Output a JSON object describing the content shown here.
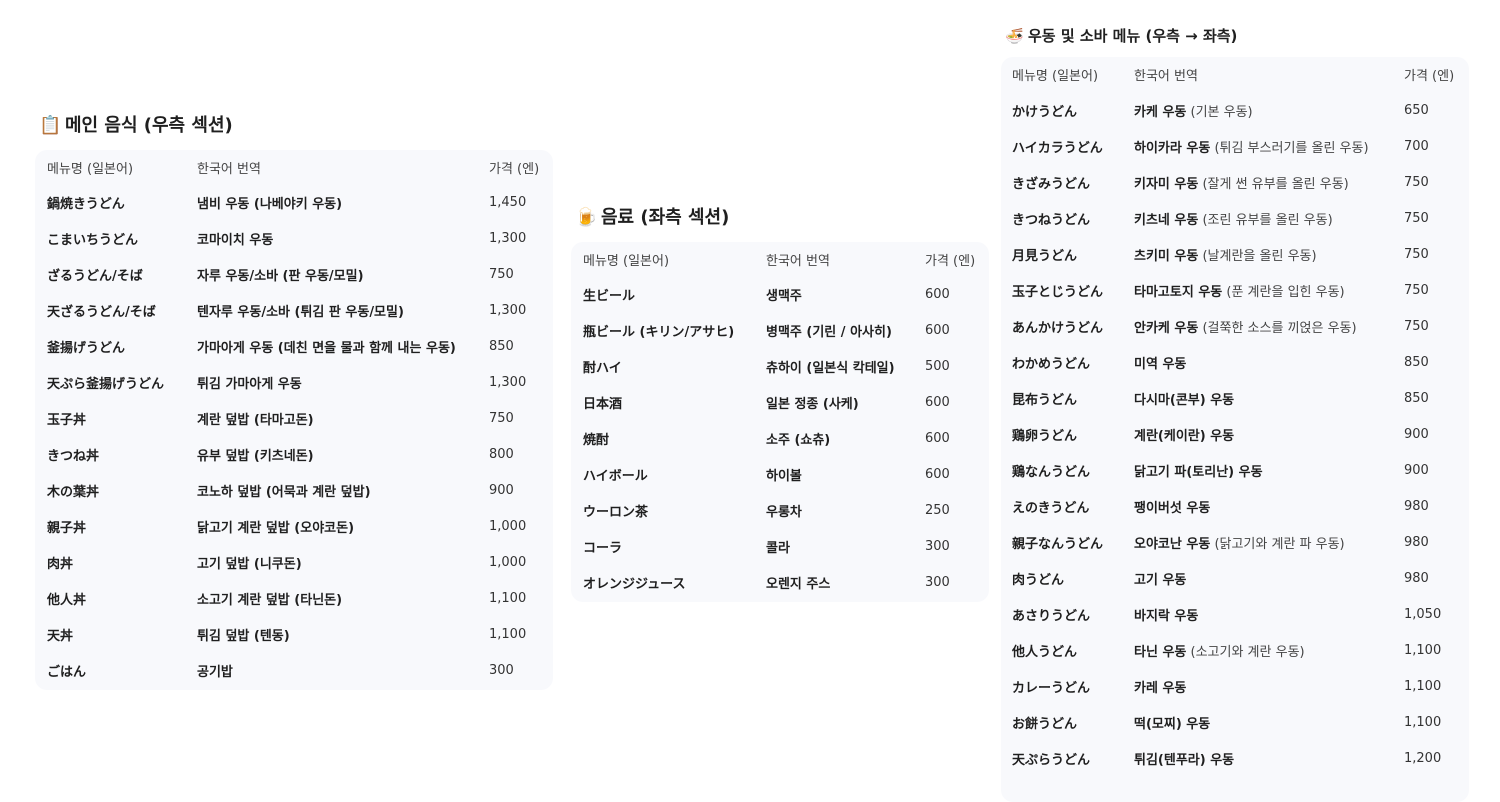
{
  "main": {
    "icon": "📋",
    "title": "메인 음식 (우측 섹션)",
    "headers": [
      "메뉴명 (일본어)",
      "한국어 번역",
      "가격 (엔)"
    ],
    "rows": [
      {
        "ja": "鍋焼きうどん",
        "ko": "냄비 우동 (나베야키 우동)",
        "note": "",
        "price": "1,450"
      },
      {
        "ja": "こまいちうどん",
        "ko": "코마이치 우동",
        "note": "",
        "price": "1,300"
      },
      {
        "ja": "ざるうどん/そば",
        "ko": "자루 우동/소바 (판 우동/모밀)",
        "note": "",
        "price": "750"
      },
      {
        "ja": "天ざるうどん/そば",
        "ko": "텐자루 우동/소바 (튀김 판 우동/모밀)",
        "note": "",
        "price": "1,300"
      },
      {
        "ja": "釜揚げうどん",
        "ko": "가마아게 우동 (데친 면을 물과 함께 내는 우동)",
        "note": "",
        "price": "850"
      },
      {
        "ja": "天ぷら釜揚げうどん",
        "ko": "튀김 가마아게 우동",
        "note": "",
        "price": "1,300"
      },
      {
        "ja": "玉子丼",
        "ko": "계란 덮밥 (타마고돈)",
        "note": "",
        "price": "750"
      },
      {
        "ja": "きつね丼",
        "ko": "유부 덮밥 (키츠네돈)",
        "note": "",
        "price": "800"
      },
      {
        "ja": "木の葉丼",
        "ko": "코노하 덮밥 (어묵과 계란 덮밥)",
        "note": "",
        "price": "900"
      },
      {
        "ja": "親子丼",
        "ko": "닭고기 계란 덮밥 (오야코돈)",
        "note": "",
        "price": "1,000"
      },
      {
        "ja": "肉丼",
        "ko": "고기 덮밥 (니쿠돈)",
        "note": "",
        "price": "1,000"
      },
      {
        "ja": "他人丼",
        "ko": "소고기 계란 덮밥 (타닌돈)",
        "note": "",
        "price": "1,100"
      },
      {
        "ja": "天丼",
        "ko": "튀김 덮밥 (텐동)",
        "note": "",
        "price": "1,100"
      },
      {
        "ja": "ごはん",
        "ko": "공기밥",
        "note": "",
        "price": "300"
      }
    ]
  },
  "drinks": {
    "icon": "🍺",
    "title": "음료 (좌측 섹션)",
    "headers": [
      "메뉴명 (일본어)",
      "한국어 번역",
      "가격 (엔)"
    ],
    "rows": [
      {
        "ja": "生ビール",
        "ko": "생맥주",
        "note": "",
        "price": "600"
      },
      {
        "ja": "瓶ビール (キリン/アサヒ)",
        "ko": "병맥주 (기린 / 아사히)",
        "note": "",
        "price": "600"
      },
      {
        "ja": "酎ハイ",
        "ko": "츄하이 (일본식 칵테일)",
        "note": "",
        "price": "500"
      },
      {
        "ja": "日本酒",
        "ko": "일본 정종 (사케)",
        "note": "",
        "price": "600"
      },
      {
        "ja": "焼酎",
        "ko": "소주 (쇼츄)",
        "note": "",
        "price": "600"
      },
      {
        "ja": "ハイボール",
        "ko": "하이볼",
        "note": "",
        "price": "600"
      },
      {
        "ja": "ウーロン茶",
        "ko": "우롱차",
        "note": "",
        "price": "250"
      },
      {
        "ja": "コーラ",
        "ko": "콜라",
        "note": "",
        "price": "300"
      },
      {
        "ja": "オレンジジュース",
        "ko": "오렌지 주스",
        "note": "",
        "price": "300"
      }
    ]
  },
  "udon": {
    "icon": "🍜",
    "title": "우동 및 소바 메뉴 (우측 → 좌측)",
    "headers": [
      "메뉴명 (일본어)",
      "한국어 번역",
      "가격 (엔)"
    ],
    "rows": [
      {
        "ja": "かけうどん",
        "ko": "카케 우동",
        "note": "(기본 우동)",
        "price": "650"
      },
      {
        "ja": "ハイカラうどん",
        "ko": "하이카라 우동",
        "note": "(튀김 부스러기를 올린 우동)",
        "price": "700"
      },
      {
        "ja": "きざみうどん",
        "ko": "키자미 우동",
        "note": "(잘게 썬 유부를 올린 우동)",
        "price": "750"
      },
      {
        "ja": "きつねうどん",
        "ko": "키츠네 우동",
        "note": "(조린 유부를 올린 우동)",
        "price": "750"
      },
      {
        "ja": "月見うどん",
        "ko": "츠키미 우동",
        "note": "(날계란을 올린 우동)",
        "price": "750"
      },
      {
        "ja": "玉子とじうどん",
        "ko": "타마고토지 우동",
        "note": "(푼 계란을 입힌 우동)",
        "price": "750"
      },
      {
        "ja": "あんかけうどん",
        "ko": "안카케 우동",
        "note": "(걸쭉한 소스를 끼얹은 우동)",
        "price": "750"
      },
      {
        "ja": "わかめうどん",
        "ko": "미역 우동",
        "note": "",
        "price": "850"
      },
      {
        "ja": "昆布うどん",
        "ko": "다시마(콘부) 우동",
        "note": "",
        "price": "850"
      },
      {
        "ja": "鶏卵うどん",
        "ko": "계란(케이란) 우동",
        "note": "",
        "price": "900"
      },
      {
        "ja": "鶏なんうどん",
        "ko": "닭고기 파(토리난) 우동",
        "note": "",
        "price": "900"
      },
      {
        "ja": "えのきうどん",
        "ko": "팽이버섯 우동",
        "note": "",
        "price": "980"
      },
      {
        "ja": "親子なんうどん",
        "ko": "오야코난 우동",
        "note": "(닭고기와 계란 파 우동)",
        "price": "980"
      },
      {
        "ja": "肉うどん",
        "ko": "고기 우동",
        "note": "",
        "price": "980"
      },
      {
        "ja": "あさりうどん",
        "ko": "바지락 우동",
        "note": "",
        "price": "1,050"
      },
      {
        "ja": "他人うどん",
        "ko": "타닌 우동",
        "note": "(소고기와 계란 우동)",
        "price": "1,100"
      },
      {
        "ja": "カレーうどん",
        "ko": "카레 우동",
        "note": "",
        "price": "1,100"
      },
      {
        "ja": "お餅うどん",
        "ko": "떡(모찌) 우동",
        "note": "",
        "price": "1,100"
      },
      {
        "ja": "天ぷらうどん",
        "ko": "튀김(텐푸라) 우동",
        "note": "",
        "price": "1,200"
      }
    ]
  }
}
